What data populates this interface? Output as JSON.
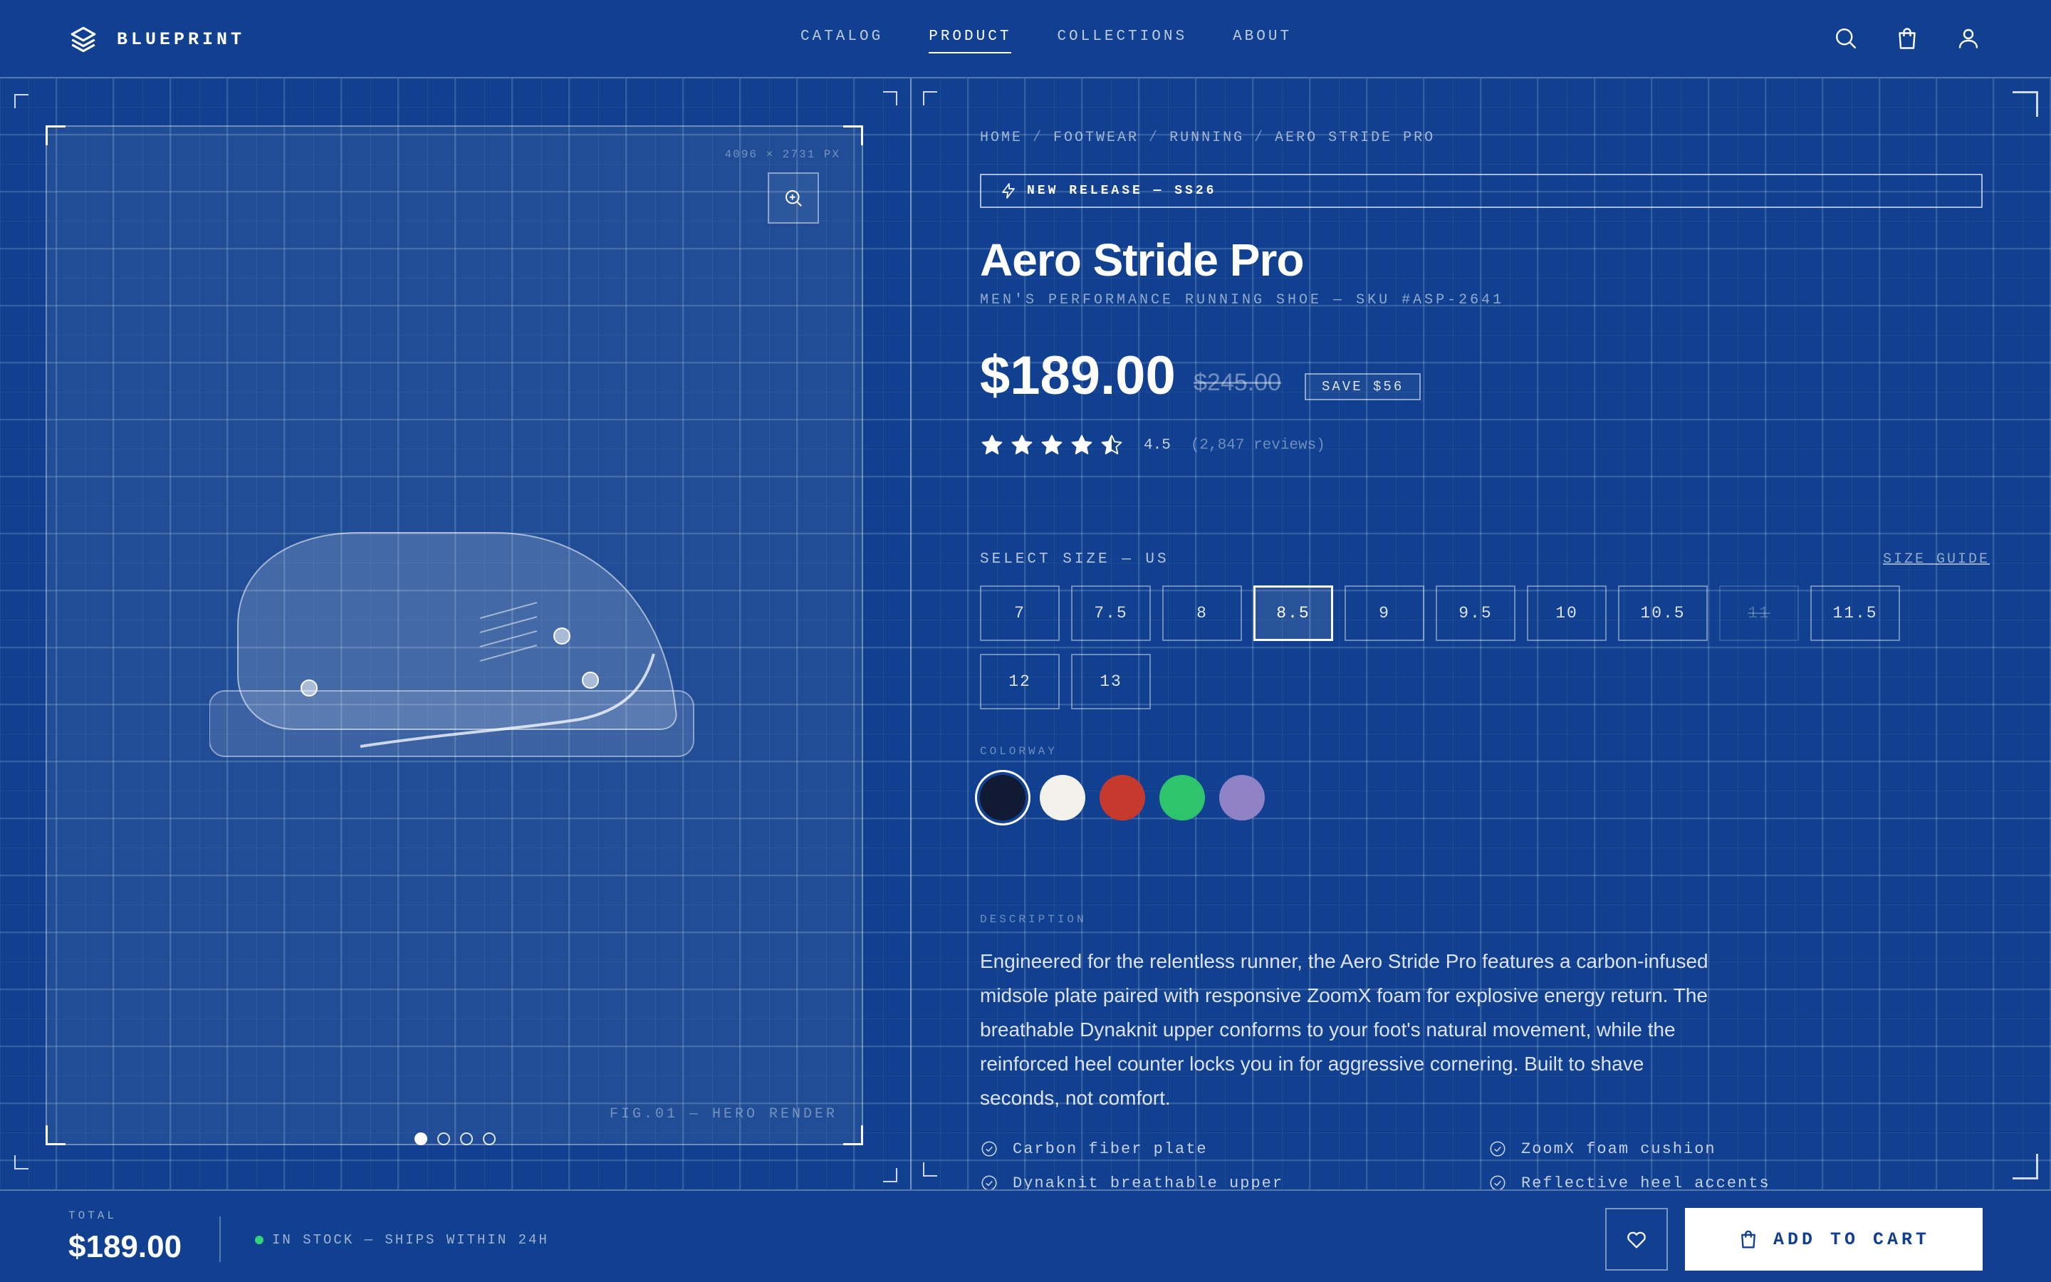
{
  "brand": {
    "name": "BLUEPRINT"
  },
  "nav": {
    "items": [
      {
        "label": "CATALOG",
        "active": false
      },
      {
        "label": "PRODUCT",
        "active": true
      },
      {
        "label": "COLLECTIONS",
        "active": false
      },
      {
        "label": "ABOUT",
        "active": false
      }
    ],
    "icons": [
      "search-icon",
      "cart-icon",
      "user-icon"
    ]
  },
  "gallery": {
    "dimensions": "4096 × 2731 PX",
    "figure_label": "FIG.01 — HERO RENDER",
    "slides": 4,
    "active_slide": 1
  },
  "breadcrumb": [
    "HOME",
    "FOOTWEAR",
    "RUNNING",
    "AERO STRIDE PRO"
  ],
  "release_badge": "NEW RELEASE — SS26",
  "product": {
    "title": "Aero Stride Pro",
    "subtitle": "MEN'S PERFORMANCE RUNNING SHOE — SKU #ASP-2641",
    "price": "$189.00",
    "old_price": "$245.00",
    "save": "SAVE $56",
    "rating": "4.5",
    "rating_value": 4.5,
    "reviews": "(2,847 reviews)"
  },
  "sizes": {
    "label": "SELECT SIZE — US",
    "guide": "SIZE GUIDE",
    "options": [
      {
        "label": "7",
        "state": "normal"
      },
      {
        "label": "7.5",
        "state": "normal"
      },
      {
        "label": "8",
        "state": "normal"
      },
      {
        "label": "8.5",
        "state": "selected"
      },
      {
        "label": "9",
        "state": "normal"
      },
      {
        "label": "9.5",
        "state": "normal"
      },
      {
        "label": "10",
        "state": "normal"
      },
      {
        "label": "10.5",
        "state": "normal"
      },
      {
        "label": "11",
        "state": "disabled"
      },
      {
        "label": "11.5",
        "state": "normal"
      },
      {
        "label": "12",
        "state": "normal"
      },
      {
        "label": "13",
        "state": "normal"
      }
    ]
  },
  "colorway": {
    "label": "COLORWAY",
    "swatches": [
      "#111a33",
      "#f2f2ea",
      "#c53a2d",
      "#2ec46b",
      "#8f83c6"
    ],
    "selected": 0
  },
  "description": {
    "label": "DESCRIPTION",
    "text": "Engineered for the relentless runner, the Aero Stride Pro features a carbon-infused midsole plate paired with responsive ZoomX foam for explosive energy return. The breathable Dynaknit upper conforms to your foot's natural movement, while the reinforced heel counter locks you in for aggressive cornering. Built to shave seconds, not comfort.",
    "features": [
      "Carbon fiber plate",
      "ZoomX foam cushion",
      "Dynaknit breathable upper",
      "Reflective heel accents"
    ]
  },
  "footer_bar": {
    "total_label": "TOTAL",
    "total": "$189.00",
    "stock": "IN STOCK — SHIPS WITHIN 24H",
    "add_to_cart": "ADD TO CART",
    "stock_color": "#34d37a"
  }
}
